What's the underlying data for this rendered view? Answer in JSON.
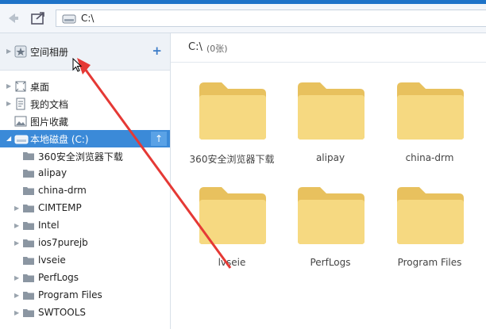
{
  "address": {
    "path": "C:\\"
  },
  "sidebar": {
    "album": {
      "label": "空间相册"
    },
    "items": [
      {
        "label": "桌面"
      },
      {
        "label": "我的文档"
      },
      {
        "label": "图片收藏"
      },
      {
        "label": "本地磁盘 (C:)"
      },
      {
        "label": "360安全浏览器下载"
      },
      {
        "label": "alipay"
      },
      {
        "label": "china-drm"
      },
      {
        "label": "CIMTEMP"
      },
      {
        "label": "Intel"
      },
      {
        "label": "ios7purejb"
      },
      {
        "label": "lvseie"
      },
      {
        "label": "PerfLogs"
      },
      {
        "label": "Program Files"
      },
      {
        "label": "SWTOOLS"
      }
    ]
  },
  "main": {
    "path": "C:\\",
    "count": "(0张)",
    "folders": [
      {
        "label": "360安全浏览器下载"
      },
      {
        "label": "alipay"
      },
      {
        "label": "china-drm"
      },
      {
        "label": "lvseie"
      },
      {
        "label": "PerfLogs"
      },
      {
        "label": "Program Files"
      }
    ]
  },
  "colors": {
    "accent": "#3b8ad8",
    "folder": "#f5d681",
    "annotation": "#e53935"
  }
}
